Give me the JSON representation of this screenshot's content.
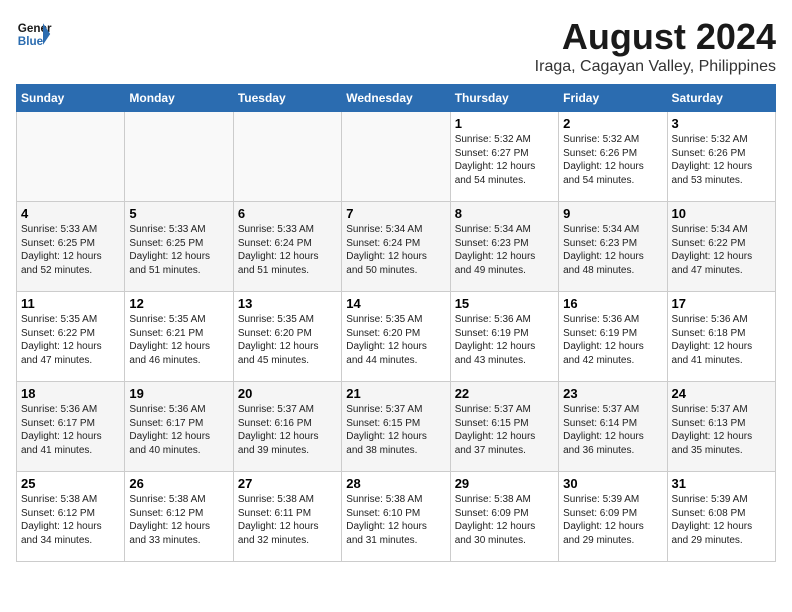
{
  "logo": {
    "line1": "General",
    "line2": "Blue"
  },
  "title": "August 2024",
  "location": "Iraga, Cagayan Valley, Philippines",
  "weekdays": [
    "Sunday",
    "Monday",
    "Tuesday",
    "Wednesday",
    "Thursday",
    "Friday",
    "Saturday"
  ],
  "weeks": [
    [
      {
        "day": "",
        "sunrise": "",
        "sunset": "",
        "daylight": ""
      },
      {
        "day": "",
        "sunrise": "",
        "sunset": "",
        "daylight": ""
      },
      {
        "day": "",
        "sunrise": "",
        "sunset": "",
        "daylight": ""
      },
      {
        "day": "",
        "sunrise": "",
        "sunset": "",
        "daylight": ""
      },
      {
        "day": "1",
        "sunrise": "5:32 AM",
        "sunset": "6:27 PM",
        "daylight": "12 hours and 54 minutes."
      },
      {
        "day": "2",
        "sunrise": "5:32 AM",
        "sunset": "6:26 PM",
        "daylight": "12 hours and 54 minutes."
      },
      {
        "day": "3",
        "sunrise": "5:32 AM",
        "sunset": "6:26 PM",
        "daylight": "12 hours and 53 minutes."
      }
    ],
    [
      {
        "day": "4",
        "sunrise": "5:33 AM",
        "sunset": "6:25 PM",
        "daylight": "12 hours and 52 minutes."
      },
      {
        "day": "5",
        "sunrise": "5:33 AM",
        "sunset": "6:25 PM",
        "daylight": "12 hours and 51 minutes."
      },
      {
        "day": "6",
        "sunrise": "5:33 AM",
        "sunset": "6:24 PM",
        "daylight": "12 hours and 51 minutes."
      },
      {
        "day": "7",
        "sunrise": "5:34 AM",
        "sunset": "6:24 PM",
        "daylight": "12 hours and 50 minutes."
      },
      {
        "day": "8",
        "sunrise": "5:34 AM",
        "sunset": "6:23 PM",
        "daylight": "12 hours and 49 minutes."
      },
      {
        "day": "9",
        "sunrise": "5:34 AM",
        "sunset": "6:23 PM",
        "daylight": "12 hours and 48 minutes."
      },
      {
        "day": "10",
        "sunrise": "5:34 AM",
        "sunset": "6:22 PM",
        "daylight": "12 hours and 47 minutes."
      }
    ],
    [
      {
        "day": "11",
        "sunrise": "5:35 AM",
        "sunset": "6:22 PM",
        "daylight": "12 hours and 47 minutes."
      },
      {
        "day": "12",
        "sunrise": "5:35 AM",
        "sunset": "6:21 PM",
        "daylight": "12 hours and 46 minutes."
      },
      {
        "day": "13",
        "sunrise": "5:35 AM",
        "sunset": "6:20 PM",
        "daylight": "12 hours and 45 minutes."
      },
      {
        "day": "14",
        "sunrise": "5:35 AM",
        "sunset": "6:20 PM",
        "daylight": "12 hours and 44 minutes."
      },
      {
        "day": "15",
        "sunrise": "5:36 AM",
        "sunset": "6:19 PM",
        "daylight": "12 hours and 43 minutes."
      },
      {
        "day": "16",
        "sunrise": "5:36 AM",
        "sunset": "6:19 PM",
        "daylight": "12 hours and 42 minutes."
      },
      {
        "day": "17",
        "sunrise": "5:36 AM",
        "sunset": "6:18 PM",
        "daylight": "12 hours and 41 minutes."
      }
    ],
    [
      {
        "day": "18",
        "sunrise": "5:36 AM",
        "sunset": "6:17 PM",
        "daylight": "12 hours and 41 minutes."
      },
      {
        "day": "19",
        "sunrise": "5:36 AM",
        "sunset": "6:17 PM",
        "daylight": "12 hours and 40 minutes."
      },
      {
        "day": "20",
        "sunrise": "5:37 AM",
        "sunset": "6:16 PM",
        "daylight": "12 hours and 39 minutes."
      },
      {
        "day": "21",
        "sunrise": "5:37 AM",
        "sunset": "6:15 PM",
        "daylight": "12 hours and 38 minutes."
      },
      {
        "day": "22",
        "sunrise": "5:37 AM",
        "sunset": "6:15 PM",
        "daylight": "12 hours and 37 minutes."
      },
      {
        "day": "23",
        "sunrise": "5:37 AM",
        "sunset": "6:14 PM",
        "daylight": "12 hours and 36 minutes."
      },
      {
        "day": "24",
        "sunrise": "5:37 AM",
        "sunset": "6:13 PM",
        "daylight": "12 hours and 35 minutes."
      }
    ],
    [
      {
        "day": "25",
        "sunrise": "5:38 AM",
        "sunset": "6:12 PM",
        "daylight": "12 hours and 34 minutes."
      },
      {
        "day": "26",
        "sunrise": "5:38 AM",
        "sunset": "6:12 PM",
        "daylight": "12 hours and 33 minutes."
      },
      {
        "day": "27",
        "sunrise": "5:38 AM",
        "sunset": "6:11 PM",
        "daylight": "12 hours and 32 minutes."
      },
      {
        "day": "28",
        "sunrise": "5:38 AM",
        "sunset": "6:10 PM",
        "daylight": "12 hours and 31 minutes."
      },
      {
        "day": "29",
        "sunrise": "5:38 AM",
        "sunset": "6:09 PM",
        "daylight": "12 hours and 30 minutes."
      },
      {
        "day": "30",
        "sunrise": "5:39 AM",
        "sunset": "6:09 PM",
        "daylight": "12 hours and 29 minutes."
      },
      {
        "day": "31",
        "sunrise": "5:39 AM",
        "sunset": "6:08 PM",
        "daylight": "12 hours and 29 minutes."
      }
    ]
  ]
}
